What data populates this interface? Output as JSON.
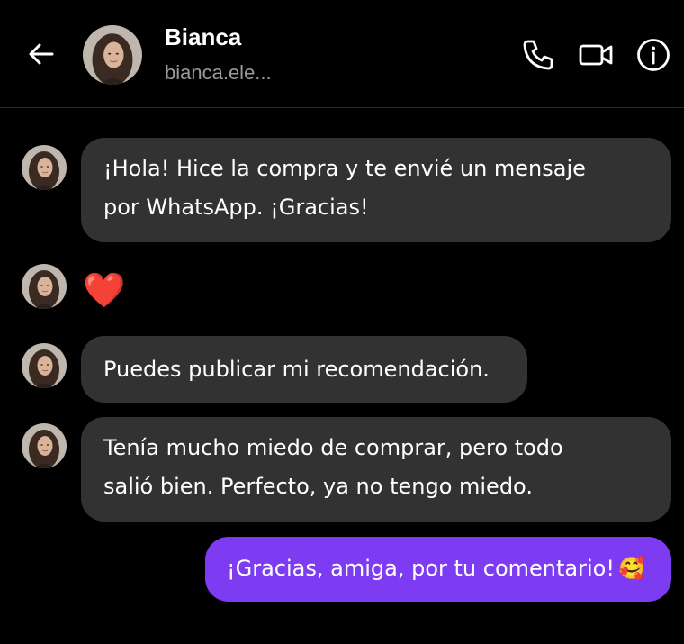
{
  "header": {
    "contact_name": "Bianca",
    "contact_handle": "bianca.ele...",
    "icons": [
      "back-arrow-icon",
      "phone-icon",
      "video-camera-icon",
      "info-icon"
    ]
  },
  "messages": [
    {
      "from": "contact",
      "text_line1": "¡Hola! Hice la compra y te envié un mensaje",
      "text_line2": "por WhatsApp. ¡Gracias!"
    },
    {
      "from": "contact",
      "emoji": "❤️"
    },
    {
      "from": "contact",
      "text": "Puedes publicar mi recomendación."
    },
    {
      "from": "contact",
      "text_line1": "Tenía mucho miedo de comprar, pero todo",
      "text_line2": "salió bien. Perfecto, ya no tengo miedo."
    },
    {
      "from": "me",
      "text": "¡Gracias, amiga, por tu comentario!",
      "emoji": "🥰"
    }
  ],
  "colors": {
    "background": "#000000",
    "received_bubble": "#323232",
    "sent_bubble": "#7d3cf2",
    "secondary_text": "#9a9a9a"
  }
}
